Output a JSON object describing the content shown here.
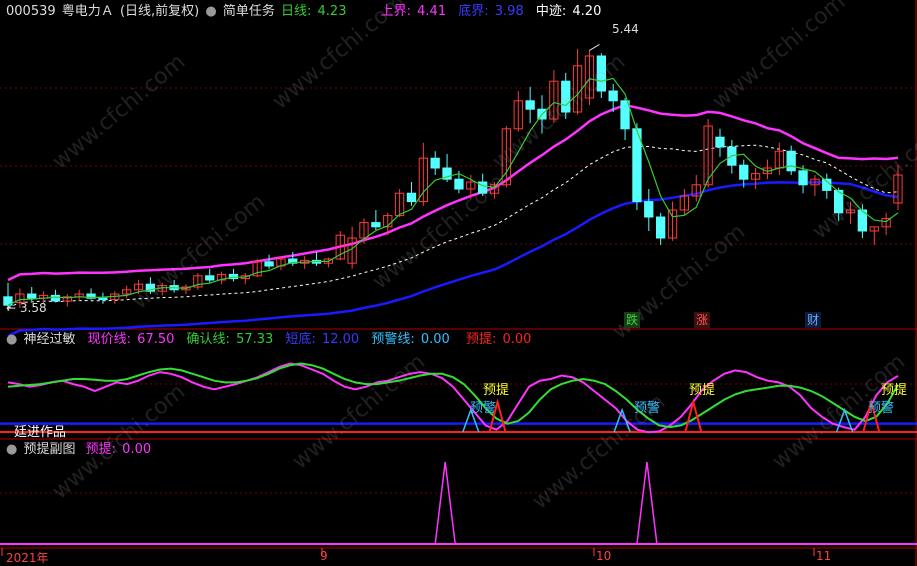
{
  "main_header": {
    "stock_code": "000539",
    "stock_name": "粤电力Ａ",
    "period": "(日线,前复权)",
    "indicator_name": "简单任务",
    "daily_line_label": "日线:",
    "daily_line_value": "4.23",
    "upper_label": "上界:",
    "upper_value": "4.41",
    "bottom_label": "底界:",
    "bottom_value": "3.98",
    "mid_label": "中迹:",
    "mid_value": "4.20"
  },
  "price_annotations": {
    "high": "5.44",
    "low": "3.58"
  },
  "price_signals": [
    "跌",
    "涨",
    "财"
  ],
  "sub1_header": {
    "name": "神经过敏",
    "now_label": "现价线:",
    "now_value": "67.50",
    "confirm_label": "确认线:",
    "confirm_value": "57.33",
    "bottom_label": "短底:",
    "bottom_value": "12.00",
    "warn_label": "预警线:",
    "warn_value": "0.00",
    "alert_label": "预提:",
    "alert_value": "0.00"
  },
  "sub1_labels": {
    "author": "廷进作品",
    "alert_mark": "预提",
    "warn_mark": "预警"
  },
  "sub2_header": {
    "name": "预提副图",
    "alert_label": "预提:",
    "alert_value": "0.00"
  },
  "time_axis": [
    "2021年",
    "9",
    "10",
    "11"
  ],
  "watermark": "www.cfchi.com",
  "colors": {
    "up": "#ff3b3b",
    "down": "#54ffff",
    "daily": "#33cc33",
    "upper": "#ff33ff",
    "bottom": "#1a1aff",
    "mid": "#ffffff",
    "grid": "#7a0000",
    "alert": "#ff2020",
    "warn": "#33c0ff",
    "header_up": "#ff33ff"
  },
  "chart_data": {
    "type": "candlestick",
    "series_main": {
      "ohlc": [
        [
          3.68,
          3.78,
          3.58,
          3.62
        ],
        [
          3.64,
          3.74,
          3.6,
          3.7
        ],
        [
          3.7,
          3.75,
          3.65,
          3.67
        ],
        [
          3.67,
          3.72,
          3.63,
          3.69
        ],
        [
          3.69,
          3.73,
          3.64,
          3.65
        ],
        [
          3.65,
          3.7,
          3.61,
          3.68
        ],
        [
          3.68,
          3.73,
          3.65,
          3.7
        ],
        [
          3.7,
          3.74,
          3.66,
          3.67
        ],
        [
          3.67,
          3.71,
          3.63,
          3.66
        ],
        [
          3.66,
          3.72,
          3.63,
          3.7
        ],
        [
          3.7,
          3.76,
          3.67,
          3.73
        ],
        [
          3.73,
          3.8,
          3.7,
          3.77
        ],
        [
          3.77,
          3.82,
          3.7,
          3.72
        ],
        [
          3.72,
          3.78,
          3.69,
          3.76
        ],
        [
          3.76,
          3.8,
          3.71,
          3.73
        ],
        [
          3.73,
          3.77,
          3.7,
          3.75
        ],
        [
          3.75,
          3.85,
          3.73,
          3.83
        ],
        [
          3.83,
          3.88,
          3.78,
          3.8
        ],
        [
          3.8,
          3.86,
          3.77,
          3.84
        ],
        [
          3.84,
          3.88,
          3.79,
          3.81
        ],
        [
          3.81,
          3.85,
          3.77,
          3.83
        ],
        [
          3.83,
          3.95,
          3.82,
          3.93
        ],
        [
          3.93,
          3.98,
          3.88,
          3.9
        ],
        [
          3.9,
          3.97,
          3.87,
          3.95
        ],
        [
          3.95,
          4.0,
          3.9,
          3.92
        ],
        [
          3.92,
          3.97,
          3.88,
          3.94
        ],
        [
          3.94,
          4.0,
          3.9,
          3.92
        ],
        [
          3.92,
          3.96,
          3.89,
          3.95
        ],
        [
          3.95,
          4.15,
          3.94,
          4.12
        ],
        [
          3.92,
          4.18,
          3.88,
          4.1
        ],
        [
          4.1,
          4.24,
          4.06,
          4.21
        ],
        [
          4.21,
          4.3,
          4.15,
          4.18
        ],
        [
          4.18,
          4.28,
          4.12,
          4.26
        ],
        [
          4.26,
          4.45,
          4.25,
          4.42
        ],
        [
          4.42,
          4.5,
          4.33,
          4.36
        ],
        [
          4.36,
          4.78,
          4.33,
          4.67
        ],
        [
          4.67,
          4.72,
          4.55,
          4.6
        ],
        [
          4.6,
          4.7,
          4.5,
          4.52
        ],
        [
          4.52,
          4.58,
          4.42,
          4.45
        ],
        [
          4.45,
          4.55,
          4.38,
          4.5
        ],
        [
          4.5,
          4.56,
          4.4,
          4.42
        ],
        [
          4.42,
          4.5,
          4.38,
          4.48
        ],
        [
          4.48,
          4.9,
          4.46,
          4.88
        ],
        [
          4.88,
          5.15,
          4.86,
          5.08
        ],
        [
          5.08,
          5.18,
          4.92,
          5.02
        ],
        [
          5.02,
          5.12,
          4.85,
          4.95
        ],
        [
          4.95,
          5.3,
          4.92,
          5.22
        ],
        [
          5.22,
          5.28,
          4.95,
          5.0
        ],
        [
          5.0,
          5.45,
          4.98,
          5.33
        ],
        [
          5.1,
          5.44,
          5.05,
          5.4
        ],
        [
          5.4,
          5.42,
          5.1,
          5.15
        ],
        [
          5.15,
          5.2,
          5.0,
          5.08
        ],
        [
          5.08,
          5.1,
          4.8,
          4.88
        ],
        [
          4.88,
          4.92,
          4.3,
          4.36
        ],
        [
          4.36,
          4.45,
          4.15,
          4.25
        ],
        [
          4.25,
          4.28,
          4.05,
          4.1
        ],
        [
          4.1,
          4.36,
          4.08,
          4.3
        ],
        [
          4.3,
          4.45,
          4.26,
          4.4
        ],
        [
          4.4,
          4.55,
          4.36,
          4.48
        ],
        [
          4.48,
          4.95,
          4.46,
          4.9
        ],
        [
          4.82,
          4.88,
          4.68,
          4.75
        ],
        [
          4.75,
          4.8,
          4.56,
          4.62
        ],
        [
          4.62,
          4.66,
          4.46,
          4.52
        ],
        [
          4.52,
          4.6,
          4.45,
          4.56
        ],
        [
          4.56,
          4.66,
          4.52,
          4.6
        ],
        [
          4.6,
          4.78,
          4.55,
          4.72
        ],
        [
          4.72,
          4.76,
          4.55,
          4.58
        ],
        [
          4.58,
          4.62,
          4.42,
          4.48
        ],
        [
          4.48,
          4.55,
          4.4,
          4.52
        ],
        [
          4.52,
          4.56,
          4.38,
          4.44
        ],
        [
          4.44,
          4.46,
          4.22,
          4.28
        ],
        [
          4.28,
          4.36,
          4.2,
          4.3
        ],
        [
          4.3,
          4.34,
          4.1,
          4.15
        ],
        [
          4.15,
          4.18,
          4.05,
          4.18
        ],
        [
          4.18,
          4.28,
          4.12,
          4.24
        ],
        [
          4.35,
          4.62,
          4.3,
          4.55
        ]
      ],
      "daily_line_last": 4.23,
      "upper_last": 4.41,
      "bottom_last": 3.98,
      "mid_last": 4.2,
      "high": 5.44,
      "low": 3.58,
      "y_range": [
        3.5,
        5.6
      ]
    },
    "series_sub1": {
      "ylim": [
        0,
        100
      ],
      "now_line": [
        60,
        58,
        55,
        57,
        60,
        62,
        58,
        55,
        50,
        55,
        60,
        58,
        62,
        68,
        72,
        70,
        66,
        60,
        55,
        52,
        55,
        58,
        62,
        66,
        72,
        78,
        82,
        80,
        75,
        70,
        62,
        55,
        52,
        55,
        60,
        62,
        66,
        70,
        72,
        70,
        65,
        55,
        40,
        25,
        10,
        5,
        15,
        35,
        55,
        62,
        64,
        68,
        66,
        60,
        50,
        40,
        30,
        15,
        5,
        2,
        3,
        10,
        20,
        35,
        52,
        62,
        70,
        74,
        72,
        66,
        62,
        60,
        55,
        45,
        30,
        20,
        12,
        8,
        5,
        20,
        45,
        60,
        67.5
      ],
      "confirm_line": [
        55,
        56,
        57,
        58,
        60,
        62,
        64,
        64,
        63,
        62,
        62,
        64,
        68,
        72,
        75,
        76,
        74,
        70,
        66,
        62,
        60,
        60,
        62,
        65,
        70,
        76,
        80,
        82,
        80,
        76,
        70,
        64,
        60,
        58,
        58,
        60,
        62,
        65,
        68,
        70,
        70,
        66,
        58,
        45,
        30,
        18,
        12,
        15,
        25,
        40,
        52,
        58,
        62,
        64,
        62,
        58,
        50,
        40,
        28,
        18,
        10,
        8,
        10,
        16,
        24,
        32,
        40,
        46,
        50,
        52,
        54,
        56,
        56,
        54,
        50,
        44,
        36,
        28,
        20,
        15,
        20,
        35,
        57.33
      ],
      "bottom_line": 12,
      "warn_line": 0
    },
    "series_sub2": {
      "ylim": [
        0,
        100
      ],
      "alert_spikes_at": [
        36,
        53,
        77
      ],
      "alert_value": 0
    }
  }
}
